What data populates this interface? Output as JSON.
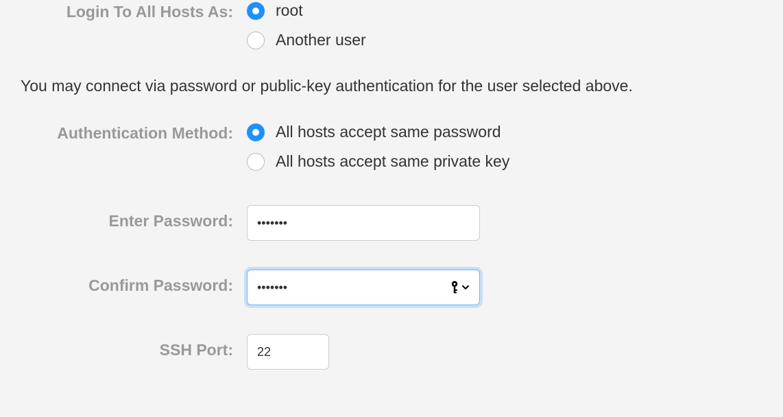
{
  "login": {
    "label": "Login To All Hosts As:",
    "options": [
      {
        "label": "root",
        "selected": true
      },
      {
        "label": "Another user",
        "selected": false
      }
    ]
  },
  "helper_text": "You may connect via password or public-key authentication for the user selected above.",
  "auth_method": {
    "label": "Authentication Method:",
    "options": [
      {
        "label": "All hosts accept same password",
        "selected": true
      },
      {
        "label": "All hosts accept same private key",
        "selected": false
      }
    ]
  },
  "enter_password": {
    "label": "Enter Password:",
    "value": "•••••••"
  },
  "confirm_password": {
    "label": "Confirm Password:",
    "value": "•••••••"
  },
  "ssh_port": {
    "label": "SSH Port:",
    "value": "22"
  }
}
